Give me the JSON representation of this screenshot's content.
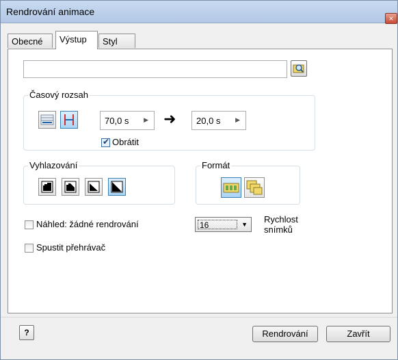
{
  "window": {
    "title": "Rendrování animace",
    "close_glyph": "×"
  },
  "tabs": [
    {
      "label": "Obecné",
      "active": false
    },
    {
      "label": "Výstup",
      "active": true
    },
    {
      "label": "Styl",
      "active": false
    }
  ],
  "output": {
    "file_path": "",
    "browse_icon": "browse-folder-icon"
  },
  "time_range": {
    "label": "Časový rozsah",
    "icons": [
      "whole-range-icon",
      "time-range-icon"
    ],
    "start_value": "70,0 s",
    "end_value": "20,0 s",
    "arrow_glyph": "➜",
    "reverse_label": "Obrátit",
    "reverse_checked": true
  },
  "smoothing": {
    "label": "Vyhlazování",
    "icons": [
      "antialias-none-icon",
      "antialias-low-icon",
      "antialias-medium-icon",
      "antialias-high-icon"
    ],
    "selected_index": 3
  },
  "format": {
    "label": "Formát",
    "icons": [
      "video-format-icon",
      "image-sequence-format-icon"
    ],
    "selected_index": 0
  },
  "preview": {
    "label": "Náhled: žádné rendrování",
    "checked": false
  },
  "launch_player": {
    "label": "Spustit přehrávač",
    "checked": false
  },
  "frame_rate": {
    "value": "16",
    "label_line1": "Rychlost",
    "label_line2": "snímků"
  },
  "footer": {
    "help_glyph": "?",
    "render_label": "Rendrování",
    "close_label": "Zavřít"
  },
  "colors": {
    "accent": "#3c7fb1",
    "title_bar": "#b2c8e6"
  }
}
